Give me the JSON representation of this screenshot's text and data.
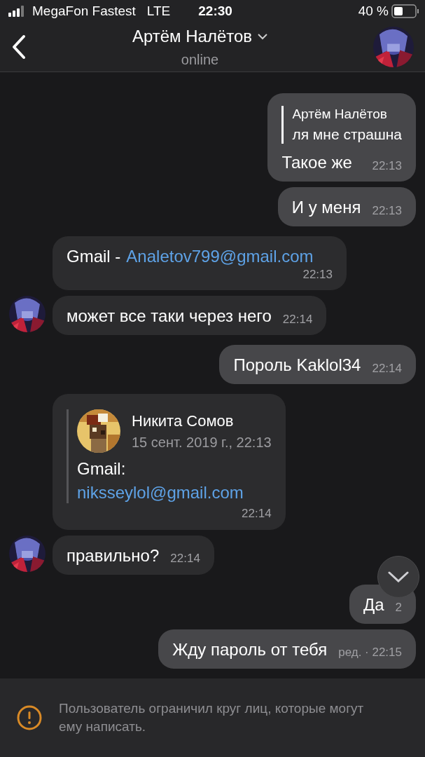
{
  "status_bar": {
    "carrier": "MegaFon Fastest",
    "network": "LTE",
    "time": "22:30",
    "battery": "40 %"
  },
  "header": {
    "title": "Артём Налётов",
    "subtitle": "online"
  },
  "messages": [
    {
      "out": true,
      "reply": {
        "author": "Артём Налётов",
        "text": "ля мне страшна"
      },
      "text": "Такое же",
      "time": "22:13"
    },
    {
      "out": true,
      "text": "И у меня",
      "time": "22:13"
    },
    {
      "out": false,
      "avatar": false,
      "text": "Gmail -",
      "link": "Analetov799@gmail.com",
      "time": "22:13"
    },
    {
      "out": false,
      "avatar": true,
      "text": "может все таки через него",
      "time": "22:14"
    },
    {
      "out": true,
      "text": "Пороль Kaklol34",
      "time": "22:14"
    },
    {
      "out": false,
      "avatar": false,
      "forward": {
        "author": "Никита Сомов",
        "date": "15 сент. 2019 г., 22:13",
        "text": "Gmail:",
        "link": "niksseylol@gmail.com"
      },
      "time": "22:14"
    },
    {
      "out": false,
      "avatar": true,
      "text": "правильно?",
      "time": "22:14"
    },
    {
      "out": true,
      "text": "Да",
      "time": "2"
    },
    {
      "out": true,
      "text": "Жду пароль от тебя",
      "time": "ред. · 22:15"
    }
  ],
  "notice": {
    "text": "Пользователь ограничил круг лиц, которые могут ему написать."
  }
}
